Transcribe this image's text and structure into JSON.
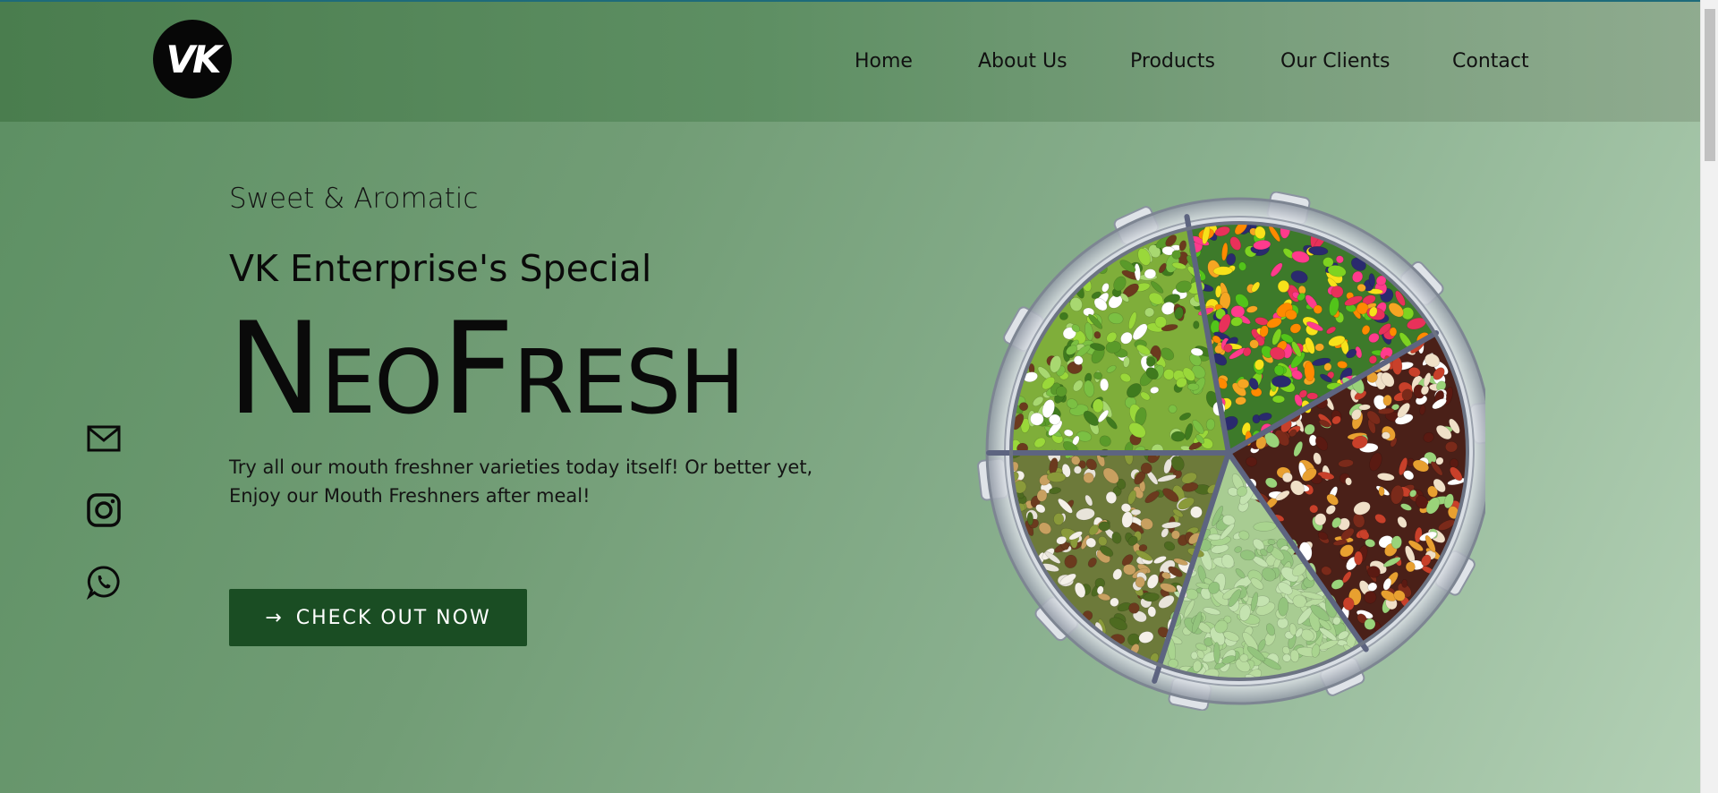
{
  "brand": {
    "logo_text": "VK"
  },
  "nav": {
    "items": [
      {
        "label": "Home"
      },
      {
        "label": "About Us"
      },
      {
        "label": "Products"
      },
      {
        "label": "Our Clients"
      },
      {
        "label": "Contact"
      }
    ]
  },
  "social": {
    "items": [
      {
        "icon": "mail-icon"
      },
      {
        "icon": "instagram-icon"
      },
      {
        "icon": "whatsapp-icon"
      }
    ]
  },
  "hero": {
    "eyebrow": "Sweet & Aromatic",
    "subtitle": "VK Enterprise's Special",
    "title_parts": [
      "N",
      "EO",
      "F",
      "RESH"
    ],
    "description_line1": "Try all our mouth freshner varieties today itself! Or better yet,",
    "description_line2": "Enjoy our Mouth Freshners after meal!",
    "cta_icon": "→",
    "cta_label": "CHECK OUT NOW"
  },
  "colors": {
    "cta_background": "#1a4d23",
    "header_background": "#4a7d4e",
    "page_accent": "#1e6b7a"
  }
}
